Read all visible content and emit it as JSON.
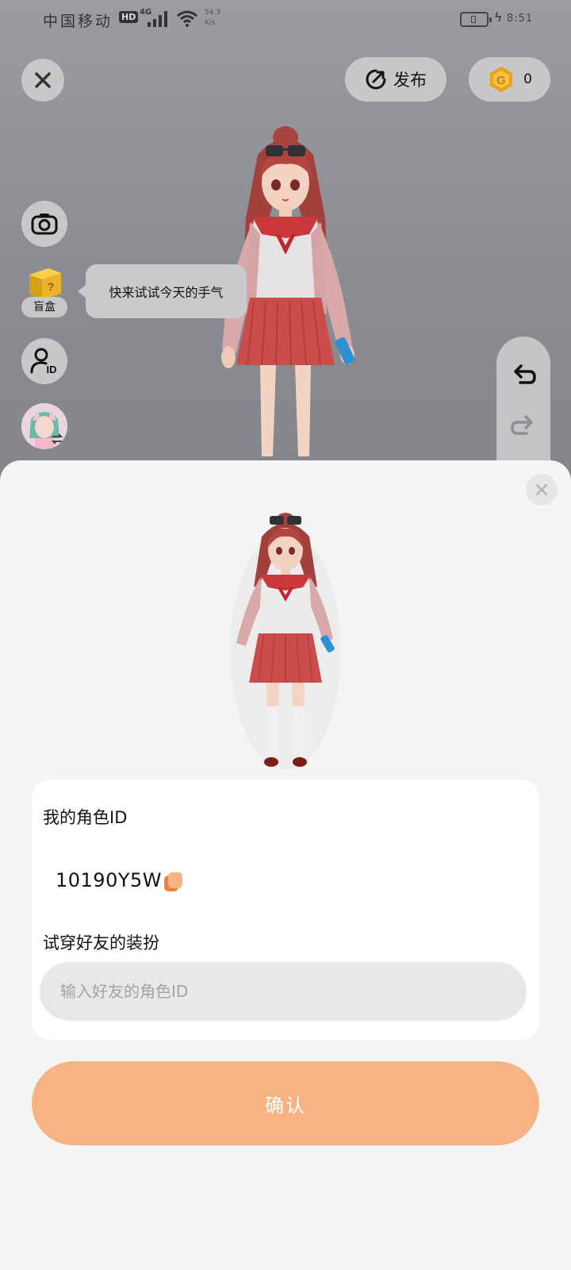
{
  "status_bar": {
    "carrier": "中国移动",
    "network_badge": "HD",
    "network_type": "4G",
    "speed_value": "54.3",
    "speed_unit": "K/s",
    "time": "8:51"
  },
  "top_bar": {
    "close_icon": "close-icon",
    "publish_label": "发布",
    "publish_icon": "publish-icon",
    "coin_icon": "coin-icon",
    "coin_count": "0"
  },
  "side_tools": {
    "camera_icon": "camera-icon",
    "blindbox_label": "盲盒",
    "blindbox_tooltip": "快来试试今天的手气",
    "id_icon": "role-id-icon",
    "switch_icon": "avatar-switch-icon"
  },
  "history": {
    "undo_icon": "undo-icon",
    "redo_icon": "redo-icon"
  },
  "sheet": {
    "close_icon": "close-icon",
    "my_id_label": "我的角色ID",
    "my_id_value": "10190Y5W",
    "copy_icon": "copy-icon",
    "try_on_label": "试穿好友的装扮",
    "friend_id_placeholder": "输入好友的角色ID",
    "confirm_label": "确认"
  },
  "colors": {
    "accent": "#f7b482",
    "coin": "#e8a31a",
    "sheet_bg": "#f5f5f5",
    "uniform_red": "#c9393c"
  }
}
